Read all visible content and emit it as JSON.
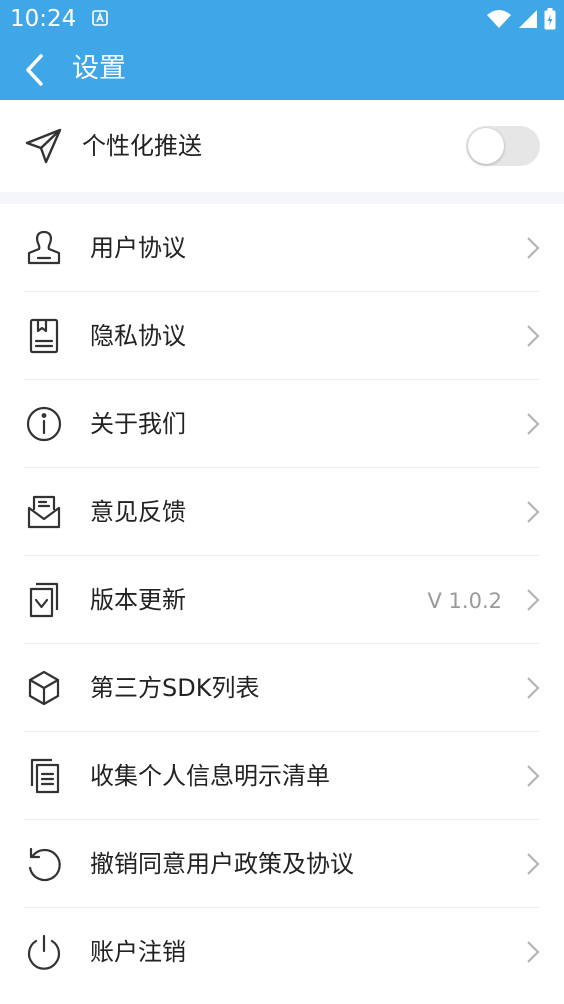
{
  "status_bar": {
    "time": "10:24",
    "notification_icon": "a-notification-icon",
    "icons": [
      "wifi-icon",
      "signal-icon",
      "battery-icon"
    ]
  },
  "header": {
    "title": "设置",
    "back_icon": "back-icon",
    "background": "#3fa6e8"
  },
  "push": {
    "label": "个性化推送",
    "icon": "paper-plane-icon",
    "enabled": false
  },
  "items": [
    {
      "label": "用户协议",
      "icon": "user-icon",
      "value": ""
    },
    {
      "label": "隐私协议",
      "icon": "bookmark-doc-icon",
      "value": ""
    },
    {
      "label": "关于我们",
      "icon": "info-icon",
      "value": ""
    },
    {
      "label": "意见反馈",
      "icon": "feedback-mail-icon",
      "value": ""
    },
    {
      "label": "版本更新",
      "icon": "download-doc-icon",
      "value": "V 1.0.2"
    },
    {
      "label": "第三方SDK列表",
      "icon": "cube-icon",
      "value": ""
    },
    {
      "label": "收集个人信息明示清单",
      "icon": "documents-icon",
      "value": ""
    },
    {
      "label": "撤销同意用户政策及协议",
      "icon": "undo-icon",
      "value": ""
    },
    {
      "label": "账户注销",
      "icon": "power-icon",
      "value": ""
    }
  ]
}
